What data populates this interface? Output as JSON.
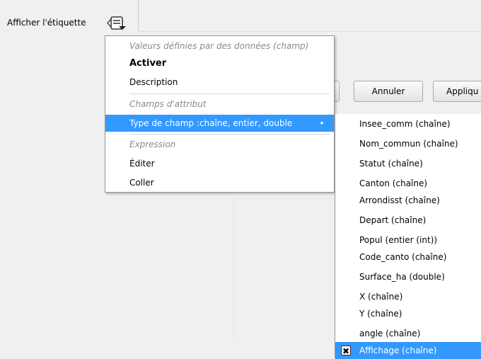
{
  "label": "Afficher l'étiquette",
  "dialog_buttons": {
    "cancel": "Annuler",
    "apply": "Appliqu"
  },
  "menu": {
    "items": [
      {
        "text": "Valeurs définies par des données (champ)",
        "style": "header"
      },
      {
        "text": "Activer",
        "style": "bold"
      },
      {
        "text": "Description",
        "style": "normal"
      },
      {
        "text": "Champs d'attribut",
        "style": "header"
      },
      {
        "text": "Type de champ :chaîne, entier, double",
        "style": "selected",
        "submenu_arrow": "▸"
      },
      {
        "text": "Expression",
        "style": "header"
      },
      {
        "text": "Éditer",
        "style": "normal"
      },
      {
        "text": "Coller",
        "style": "normal"
      }
    ]
  },
  "submenu": {
    "items": [
      "Insee_comm   (chaîne)",
      "Nom_commun   (chaîne)",
      "Statut   (chaîne)",
      "Canton   (chaîne)",
      "Arrondisst   (chaîne)",
      "Depart   (chaîne)",
      "Popul   (entier (int))",
      "Code_canto   (chaîne)",
      "Surface_ha   (double)",
      "X   (chaîne)",
      "Y   (chaîne)",
      "angle   (chaîne)",
      "Affichage   (chaîne)"
    ],
    "checked_mark": "✖"
  },
  "colors": {
    "selection": "#3399ff",
    "header_text": "#8a8a8a"
  }
}
